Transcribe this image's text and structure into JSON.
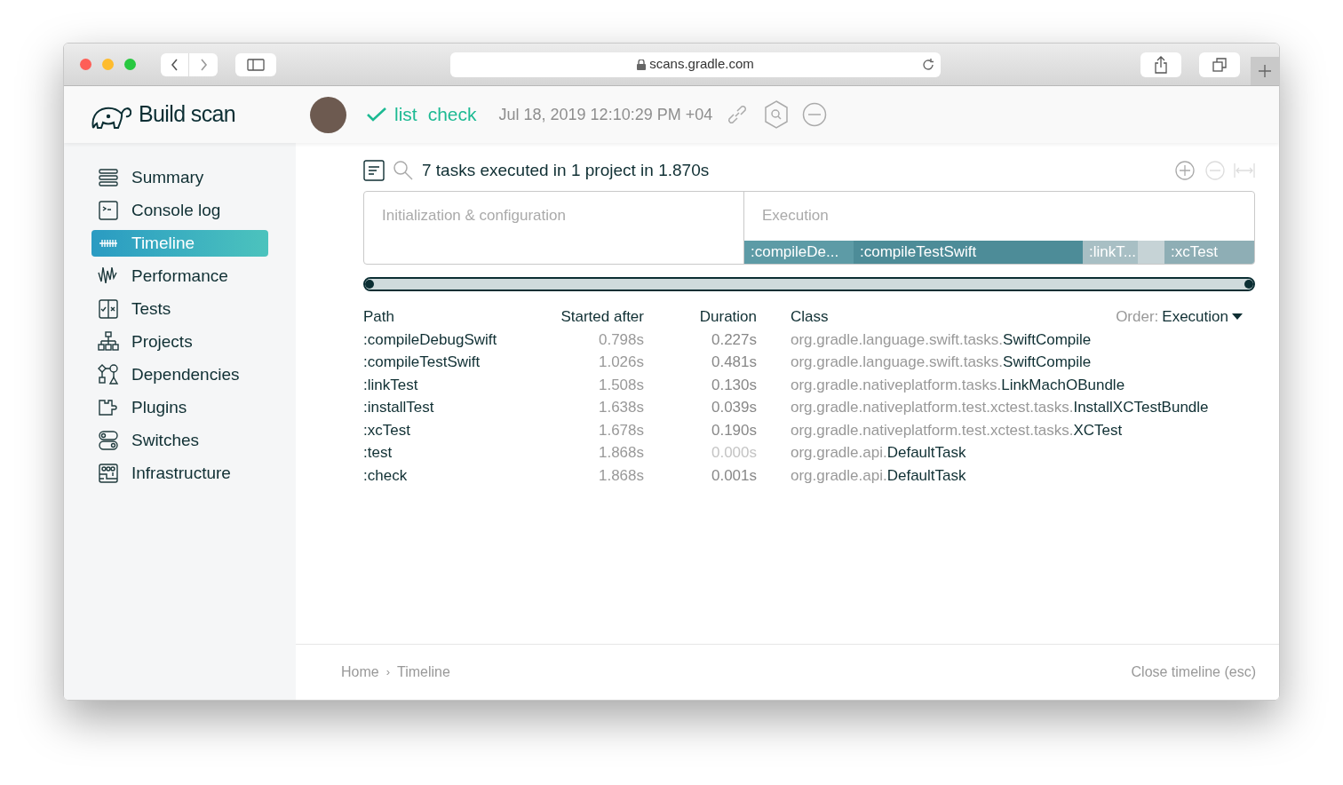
{
  "browser": {
    "url": "scans.gradle.com"
  },
  "header": {
    "title": "Build scan",
    "tasks": [
      {
        "label": "list"
      },
      {
        "label": "check"
      }
    ],
    "date": "Jul 18, 2019 12:10:29 PM +04"
  },
  "sidebar": {
    "items": [
      {
        "label": "Summary",
        "kind": "summary",
        "selected": false
      },
      {
        "label": "Console log",
        "kind": "console",
        "selected": false
      },
      {
        "label": "Timeline",
        "kind": "timeline",
        "selected": true
      },
      {
        "label": "Performance",
        "kind": "performance",
        "selected": false
      },
      {
        "label": "Tests",
        "kind": "tests",
        "selected": false
      },
      {
        "label": "Projects",
        "kind": "projects",
        "selected": false
      },
      {
        "label": "Dependencies",
        "kind": "dependencies",
        "selected": false
      },
      {
        "label": "Plugins",
        "kind": "plugins",
        "selected": false
      },
      {
        "label": "Switches",
        "kind": "switches",
        "selected": false
      },
      {
        "label": "Infrastructure",
        "kind": "infrastructure",
        "selected": false
      }
    ]
  },
  "timeline": {
    "summary": "7 tasks executed in 1 project in 1.870s",
    "phases": [
      {
        "label": "Initialization & configuration"
      },
      {
        "label": "Execution"
      }
    ],
    "bars": [
      {
        "label": ":compileDe...",
        "color": "#5d9ba6"
      },
      {
        "label": ":compileTestSwift",
        "color": "#4d8c98"
      },
      {
        "label": ":linkT...",
        "color": "#a8bfc4"
      },
      {
        "color": "#c6d3d6"
      },
      {
        "label": ":xcTest",
        "color": "#8eaeb5"
      }
    ],
    "range": {
      "level": 1
    }
  },
  "table": {
    "columns": [
      "Path",
      "Started after",
      "Duration",
      "Class"
    ],
    "order_label": "Order:",
    "order_value": "Execution",
    "rows": [
      {
        "path": ":compileDebugSwift",
        "started": "0.798s",
        "duration": "0.227s",
        "dimmed": false,
        "class_package": "org.gradle.language.swift.tasks.",
        "class_name": "SwiftCompile"
      },
      {
        "path": ":compileTestSwift",
        "started": "1.026s",
        "duration": "0.481s",
        "dimmed": false,
        "class_package": "org.gradle.language.swift.tasks.",
        "class_name": "SwiftCompile"
      },
      {
        "path": ":linkTest",
        "started": "1.508s",
        "duration": "0.130s",
        "dimmed": false,
        "class_package": "org.gradle.nativeplatform.tasks.",
        "class_name": "LinkMachOBundle"
      },
      {
        "path": ":installTest",
        "started": "1.638s",
        "duration": "0.039s",
        "dimmed": false,
        "class_package": "org.gradle.nativeplatform.test.xctest.tasks.",
        "class_name": "InstallXCTestBundle"
      },
      {
        "path": ":xcTest",
        "started": "1.678s",
        "duration": "0.190s",
        "dimmed": false,
        "class_package": "org.gradle.nativeplatform.test.xctest.tasks.",
        "class_name": "XCTest"
      },
      {
        "path": ":test",
        "started": "1.868s",
        "duration": "0.000s",
        "dimmed": true,
        "class_package": "org.gradle.api.",
        "class_name": "DefaultTask"
      },
      {
        "path": ":check",
        "started": "1.868s",
        "duration": "0.001s",
        "dimmed": false,
        "class_package": "org.gradle.api.",
        "class_name": "DefaultTask"
      }
    ]
  },
  "footer": {
    "breadcrumbs": [
      "Home",
      "Timeline"
    ],
    "separator": "›",
    "close": "Close timeline (esc)"
  }
}
